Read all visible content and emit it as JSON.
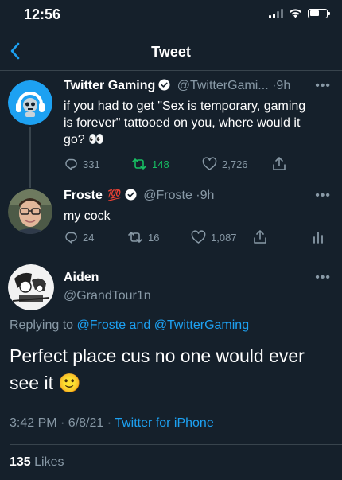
{
  "status_bar": {
    "time": "12:56"
  },
  "header": {
    "title": "Tweet"
  },
  "tweets": [
    {
      "name": "Twitter Gaming",
      "handle": "@TwitterGami...",
      "time": "9h",
      "text": "if you had to get \"Sex is temporary, gaming is forever\" tattooed on you, where would it go? 👀",
      "actions": {
        "replies": "331",
        "retweets": "148",
        "likes": "2,726"
      },
      "retweeted": true
    },
    {
      "name": "Froste",
      "name_emoji": "💯",
      "handle": "@Froste",
      "time": "9h",
      "text": "my cock",
      "actions": {
        "replies": "24",
        "retweets": "16",
        "likes": "1,087"
      }
    }
  ],
  "main_tweet": {
    "name": "Aiden",
    "handle": "@GrandTour1n",
    "replying_prefix": "Replying to",
    "replying_to_1": "@Froste",
    "replying_and": "and",
    "replying_to_2": "@TwitterGaming",
    "text": "Perfect place cus no one would ever see it 🙂",
    "timestamp": "3:42 PM · 6/8/21 ·",
    "client": "Twitter for iPhone",
    "likes_count": "135",
    "likes_label": "Likes"
  },
  "colors": {
    "background": "#15202b",
    "accent": "#1da1f2",
    "muted": "#8899a6",
    "retweet_green": "#17bf63",
    "divider": "#38444d"
  }
}
